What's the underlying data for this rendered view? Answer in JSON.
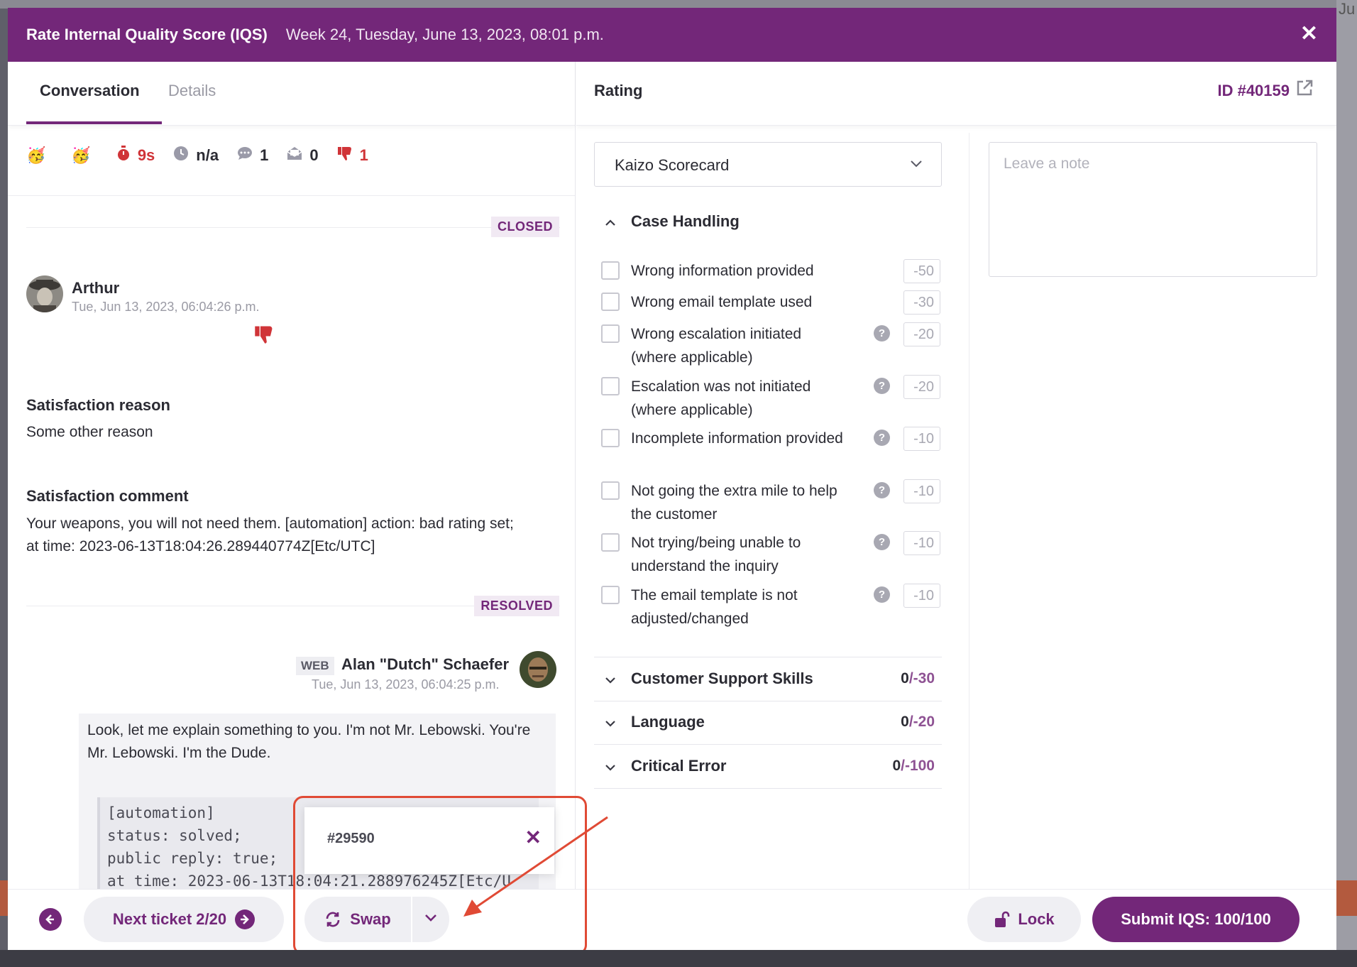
{
  "background": {
    "right_text": "Ju"
  },
  "header": {
    "title": "Rate Internal Quality Score (IQS)",
    "date": "Week 24, Tuesday, June 13, 2023, 08:01 p.m.",
    "close_icon": "close-icon"
  },
  "tabs": [
    {
      "label": "Conversation",
      "active": true
    },
    {
      "label": "Details",
      "active": false
    }
  ],
  "stats": {
    "emoji_1": "🥳",
    "emoji_2": "🥳",
    "time_icon": "stopwatch-icon",
    "time": "9s",
    "clock_icon": "clock-icon",
    "clock": "n/a",
    "comments_icon": "comment-icon",
    "comments": "1",
    "mail_icon": "mail-open-icon",
    "mail": "0",
    "thumbs_icon": "thumbs-down-icon",
    "thumbs": "1"
  },
  "conversation": {
    "closed_badge": "CLOSED",
    "rating_author": "Arthur",
    "rating_time": "Tue, Jun 13, 2023, 06:04:26 p.m.",
    "reason_title": "Satisfaction reason",
    "reason_text": "Some other reason",
    "comment_title": "Satisfaction comment",
    "comment_text": "Your weapons, you will not need them. [automation] action: bad rating set; at time: 2023-06-13T18:04:26.289440774Z[Etc/UTC]",
    "resolved_badge": "RESOLVED",
    "message_channel": "WEB",
    "message_author": "Alan \"Dutch\" Schaefer",
    "message_time": "Tue, Jun 13, 2023, 06:04:25 p.m.",
    "message_text": "Look, let me explain something to you. I'm not Mr. Lebowski. You're Mr. Lebowski. I'm the Dude.",
    "code_text": "[automation]\nstatus: solved;\npublic reply: true;\nat time: 2023-06-13T18:04:21.288976245Z[Etc/U"
  },
  "popover": {
    "ticket_id": "#29590"
  },
  "rating": {
    "title": "Rating",
    "id": "ID #40159",
    "scorecard": "Kaizo Scorecard",
    "note_placeholder": "Leave a note",
    "open_category": "Case Handling",
    "items": [
      {
        "label": "Wrong information provided",
        "points": "-50",
        "help": false
      },
      {
        "label": "Wrong email template used",
        "points": "-30",
        "help": false
      },
      {
        "label": "Wrong escalation initiated (where applicable)",
        "points": "-20",
        "help": true
      },
      {
        "label": "Escalation was not initiated (where applicable)",
        "points": "-20",
        "help": true
      },
      {
        "label": "Incomplete information provided",
        "points": "-10",
        "help": true
      },
      {
        "label": "Not going the extra mile to help the customer",
        "points": "-10",
        "help": true
      },
      {
        "label": "Not trying/being unable to understand the inquiry",
        "points": "-10",
        "help": true
      },
      {
        "label": "The email template is not adjusted/changed",
        "points": "-10",
        "help": true
      }
    ],
    "help_glyph": "?",
    "collapsed_categories": [
      {
        "label": "Customer Support Skills",
        "score": "0",
        "max": "/-30"
      },
      {
        "label": "Language",
        "score": "0",
        "max": "/-20"
      },
      {
        "label": "Critical Error",
        "score": "0",
        "max": "/-100"
      }
    ]
  },
  "footer": {
    "next_label": "Next ticket 2/20",
    "swap_label": "Swap",
    "lock_label": "Lock",
    "submit_label": "Submit IQS: 100/100"
  },
  "colors": {
    "brand": "#732779",
    "danger": "#d03438",
    "annotation": "#e04a35"
  }
}
